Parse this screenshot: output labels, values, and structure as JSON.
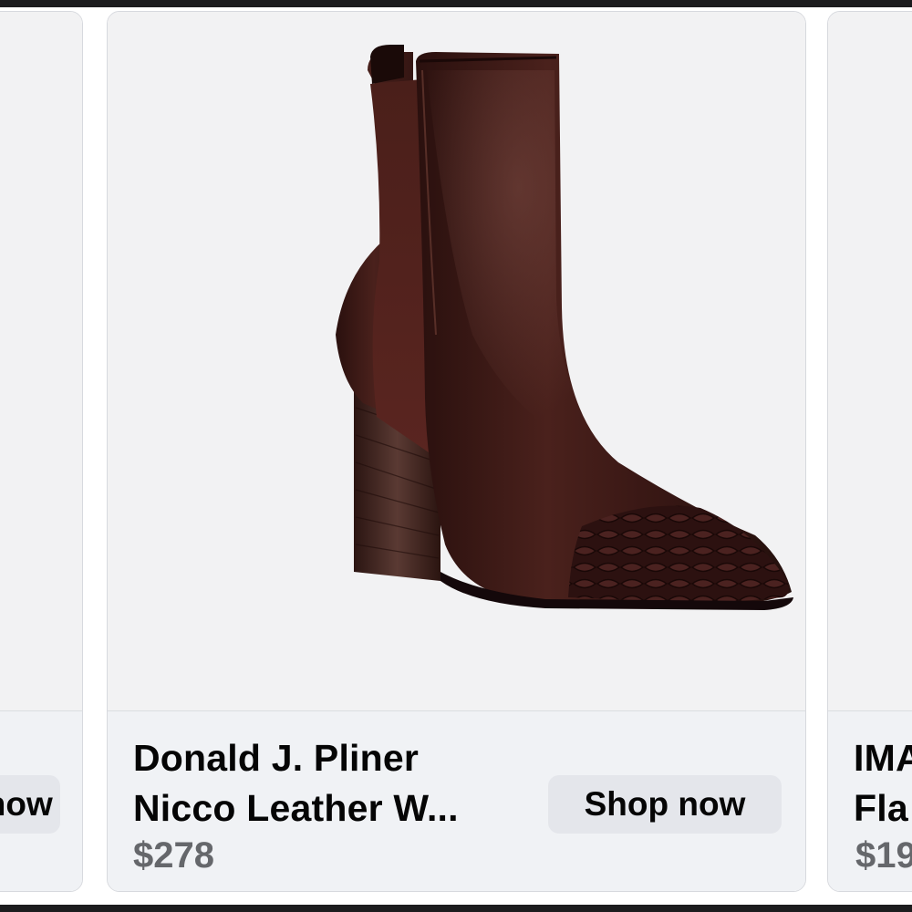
{
  "carousel": {
    "left_card": {
      "button_label": "Shop now"
    },
    "main_card": {
      "title_line1": "Donald J. Pliner",
      "title_line2": "Nicco Leather W...",
      "price": "$278",
      "button_label": "Shop now",
      "image_icon": "ankle-boot-image"
    },
    "right_card": {
      "title_line1": "IMA",
      "title_line2": "Fla",
      "price": "$19"
    }
  },
  "colors": {
    "card_footer": "#f0f2f5",
    "button_bg": "#e4e6eb",
    "title_text": "#050505",
    "price_text": "#65676b",
    "boot_leather": "#3b1a17"
  }
}
